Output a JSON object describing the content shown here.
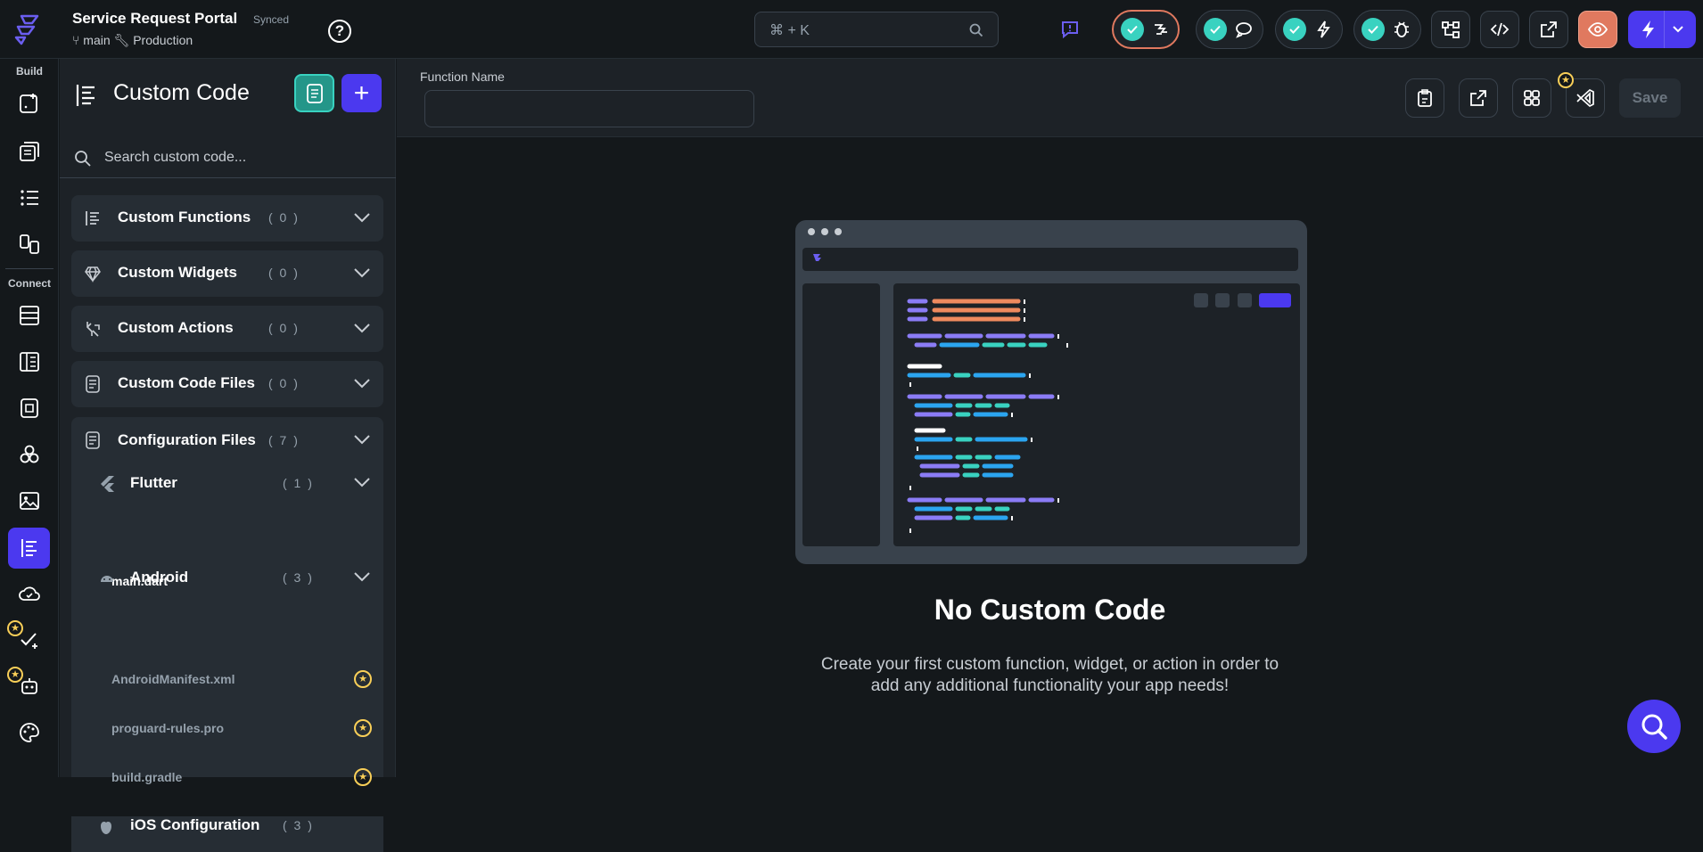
{
  "header": {
    "project_title": "Service Request Portal",
    "sync_status": "Synced",
    "branch": "main",
    "environment": "Production",
    "search_shortcut": "⌘ + K"
  },
  "rail": {
    "build_label": "Build",
    "connect_label": "Connect"
  },
  "panel": {
    "title": "Custom Code",
    "search_placeholder": "Search custom code...",
    "sections": [
      {
        "label": "Custom Functions",
        "count": "( 0 )",
        "icon": "functions-icon"
      },
      {
        "label": "Custom Widgets",
        "count": "( 0 )",
        "icon": "gem-icon"
      },
      {
        "label": "Custom Actions",
        "count": "( 0 )",
        "icon": "action-icon"
      },
      {
        "label": "Custom Code Files",
        "count": "( 0 )",
        "icon": "file-icon"
      }
    ],
    "config": {
      "label": "Configuration Files",
      "count": "( 7 )",
      "flutter": {
        "label": "Flutter",
        "count": "( 1 )",
        "files": [
          "main.dart"
        ]
      },
      "android": {
        "label": "Android",
        "count": "( 3 )",
        "files": [
          "AndroidManifest.xml",
          "proguard-rules.pro",
          "build.gradle"
        ]
      },
      "ios": {
        "label": "iOS Configuration",
        "count": "( 3 )"
      }
    }
  },
  "editor": {
    "function_name_label": "Function Name",
    "function_name_value": "",
    "save_label": "Save",
    "empty_title": "No Custom Code",
    "empty_desc_line1": "Create your first custom function, widget, or action in order to",
    "empty_desc_line2": "add any additional functionality your app needs!"
  },
  "colors": {
    "primary": "#4b39ef",
    "accent_teal": "#39d2c0",
    "star": "#f9cf58",
    "background": "#14181b",
    "surface": "#1d2227"
  }
}
